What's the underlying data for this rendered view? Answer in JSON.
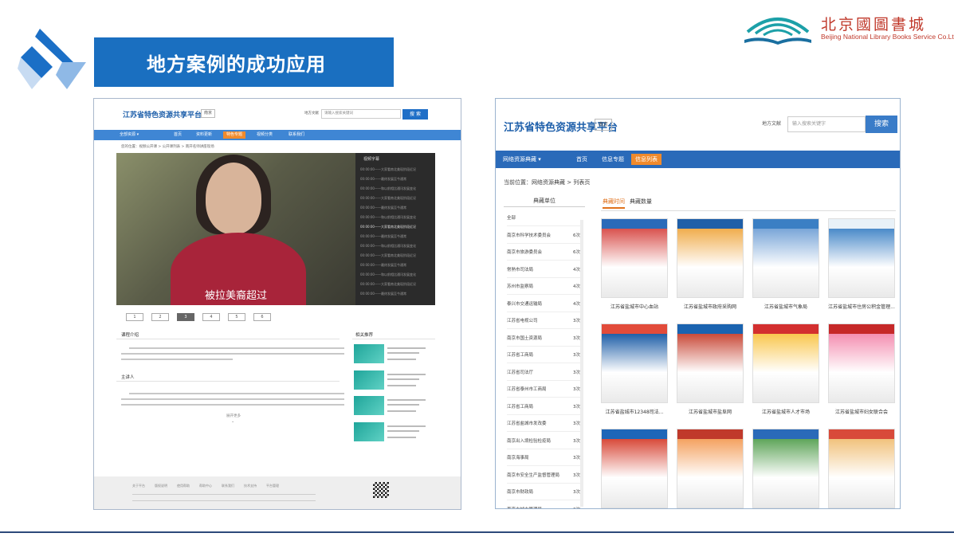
{
  "slide": {
    "title": "地方案例的成功应用",
    "brand_cn": "北京國圖書城",
    "brand_en": "Beijing National Library Books Service Co.Ltd."
  },
  "left_site": {
    "logo": "江苏省特色资源共享平台",
    "region": "南京",
    "search_type": "地方文献",
    "search_placeholder": "请输入搜索关键词",
    "search_button": "搜 索",
    "nav": [
      "全部资源 ▾",
      "首页",
      "资料更新",
      "特色专题",
      "视频分类",
      "联系我们"
    ],
    "active_nav_index": 3,
    "breadcrumb": "您的位置：视频公开课 > 公开课列表 > 南开名师讲座现场",
    "subtitle": "被拉美裔超过",
    "playlist_title": "视频字幕",
    "pages": [
      "1",
      "2",
      "3",
      "4",
      "5",
      "6"
    ],
    "active_page_index": 2,
    "course_intro_title": "课程介绍",
    "lecturer_title": "主讲人",
    "related_title": "相关推荐",
    "expand_label": "展开更多",
    "footer_links": [
      "关于平台",
      "版权说明",
      "使用帮助",
      "帮助中心",
      "联系我们",
      "技术支持",
      "平台管理"
    ]
  },
  "right_site": {
    "logo": "江苏省特色资源共享平台",
    "region": "南京",
    "search_type": "地方文献",
    "search_placeholder": "输入搜索关键字",
    "search_button": "搜索",
    "nav": [
      "网络资源典藏 ▾",
      "首页",
      "信息专题",
      "信息列表"
    ],
    "active_nav_index": 3,
    "breadcrumb": "当前位置：网络资源典藏 > 列表页",
    "sidebar_title": "典藏单位",
    "sidebar_items": [
      {
        "name": "全部",
        "count": ""
      },
      {
        "name": "南京市科学技术委员会",
        "count": "6次"
      },
      {
        "name": "南京市旅游委员会",
        "count": "6次"
      },
      {
        "name": "常熟市司法局",
        "count": "4次"
      },
      {
        "name": "苏州市监察局",
        "count": "4次"
      },
      {
        "name": "泰兴市交通运输局",
        "count": "4次"
      },
      {
        "name": "江苏省电视公司",
        "count": "3次"
      },
      {
        "name": "南京市国土资源局",
        "count": "3次"
      },
      {
        "name": "江苏省工商局",
        "count": "3次"
      },
      {
        "name": "江苏省司法厅",
        "count": "3次"
      },
      {
        "name": "江苏省泰州市工商局",
        "count": "3次"
      },
      {
        "name": "江苏省工商局",
        "count": "3次"
      },
      {
        "name": "江苏省盐城市发改委",
        "count": "3次"
      },
      {
        "name": "南京出入境检验检疫局",
        "count": "3次"
      },
      {
        "name": "南京海事局",
        "count": "3次"
      },
      {
        "name": "南京市安全生产监督管理局",
        "count": "3次"
      },
      {
        "name": "南京市财政局",
        "count": "3次"
      },
      {
        "name": "南京市城市管理局",
        "count": "3次"
      }
    ],
    "tabs": [
      "典藏时间",
      "典藏数量"
    ],
    "active_tab_index": 0,
    "cards": [
      "江苏省盐城市中心血站",
      "江苏省盐城市政府采购网",
      "江苏省盐城市气象局",
      "江苏省盐城市住房公积金管理...",
      "江苏省盐城市12348司法...",
      "江苏省盐城市盐阜网",
      "江苏省盐城市人才市场",
      "江苏省盐城市妇女联合会",
      "",
      "",
      "",
      ""
    ]
  },
  "colors": {
    "banner": "#1a6fc0",
    "nav_blue": "#2a6ab9",
    "accent_orange": "#f08a2c",
    "brand_red": "#c0392b"
  }
}
